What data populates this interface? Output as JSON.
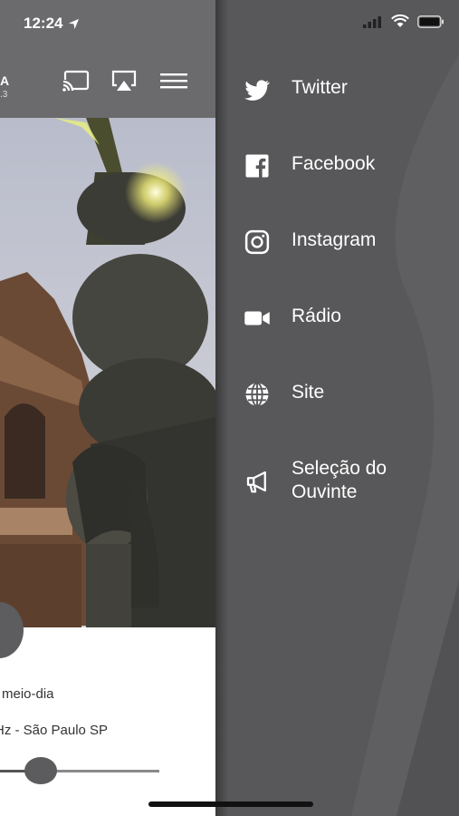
{
  "status_bar": {
    "time": "12:24",
    "icons": [
      "location-arrow-icon",
      "signal-icon",
      "wifi-icon",
      "battery-icon"
    ]
  },
  "app": {
    "logo_fragment": "A",
    "logo_sub": ".3",
    "header_icons": [
      "cast-icon",
      "airplay-icon",
      "hamburger-menu-icon"
    ],
    "program_line": "meio-dia",
    "station_line": "Hz - São Paulo SP",
    "volume": 0.2
  },
  "menu": {
    "items": [
      {
        "label": "Twitter",
        "icon": "twitter-icon"
      },
      {
        "label": "Facebook",
        "icon": "facebook-icon"
      },
      {
        "label": "Instagram",
        "icon": "instagram-icon"
      },
      {
        "label": "Rádio",
        "icon": "video-camera-icon"
      },
      {
        "label": "Site",
        "icon": "globe-icon"
      },
      {
        "label": "Seleção do\nOuvinte",
        "icon": "megaphone-icon"
      }
    ]
  },
  "colors": {
    "drawer_bg": "#58585a",
    "header_bg": "#6b6b6e",
    "menu_text": "#ffffff"
  }
}
